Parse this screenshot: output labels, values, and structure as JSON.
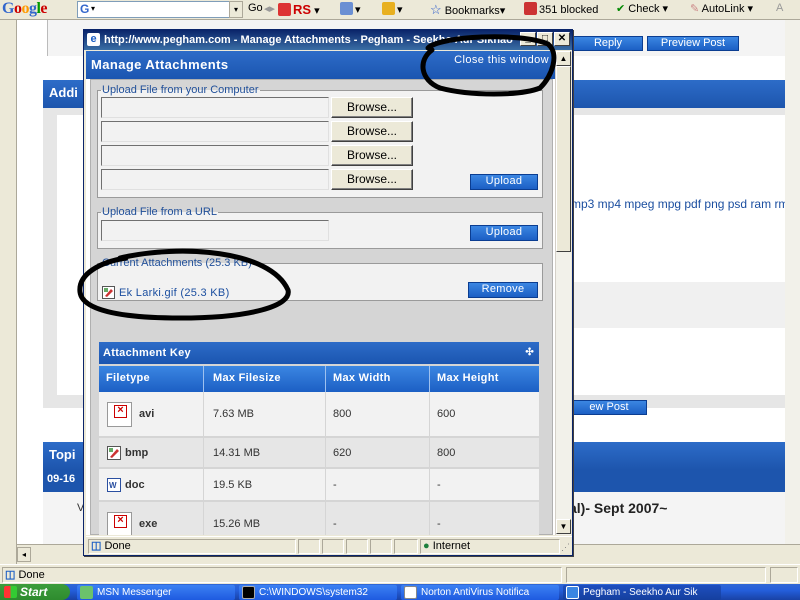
{
  "toolbar": {
    "google_logo": "Google",
    "search_icon": "G",
    "items": [
      {
        "id": "go",
        "label": "Go"
      },
      {
        "id": "rs",
        "label": "RS"
      },
      {
        "id": "bookmarks",
        "label": "Bookmarks"
      },
      {
        "id": "blocked",
        "label": "351 blocked"
      },
      {
        "id": "check",
        "label": "Check"
      },
      {
        "id": "autolink",
        "label": "AutoLink"
      }
    ]
  },
  "background": {
    "reply_btn": "Reply",
    "preview_btn": "Preview Post",
    "section_label": "Addi",
    "file_types_text": "mp3 mp4 mpeg mpg pdf png psd ram rm",
    "preview_btn_2": "ew Post",
    "topic_label": "Topi",
    "date_label": "09-16",
    "v_label": "V",
    "title_fragment": "al)- Sept 2007~"
  },
  "popup": {
    "title": "http://www.pegham.com - Manage Attachments - Pegham - Seekho Aur Sikhao",
    "header": "Manage Attachments",
    "close_link": "Close this window",
    "upload_computer": {
      "legend": "Upload File from your Computer",
      "browse_label": "Browse...",
      "upload_label": "Upload"
    },
    "upload_url": {
      "legend": "Upload File from a URL",
      "upload_label": "Upload"
    },
    "current": {
      "legend": "Current Attachments (25.3 KB)",
      "file": "Ek Larki.gif (25.3 KB)",
      "remove_label": "Remove"
    },
    "key": {
      "title": "Attachment Key",
      "columns": [
        "Filetype",
        "Max Filesize",
        "Max Width",
        "Max Height"
      ],
      "rows": [
        {
          "type": "avi",
          "size": "7.63 MB",
          "width": "800",
          "height": "600"
        },
        {
          "type": "bmp",
          "size": "14.31 MB",
          "width": "620",
          "height": "800"
        },
        {
          "type": "doc",
          "size": "19.5 KB",
          "width": "-",
          "height": "-"
        },
        {
          "type": "exe",
          "size": "15.26 MB",
          "width": "-",
          "height": "-"
        }
      ]
    },
    "status": {
      "text": "Done",
      "zone": "Internet"
    }
  },
  "outer_status": {
    "text": "Done"
  },
  "taskbar": {
    "start": "Start",
    "tasks": [
      {
        "label": "MSN Messenger"
      },
      {
        "label": "C:\\WINDOWS\\system32"
      },
      {
        "label": "Norton AntiVirus Notifica"
      },
      {
        "label": "Pegham - Seekho Aur Sik"
      }
    ]
  }
}
